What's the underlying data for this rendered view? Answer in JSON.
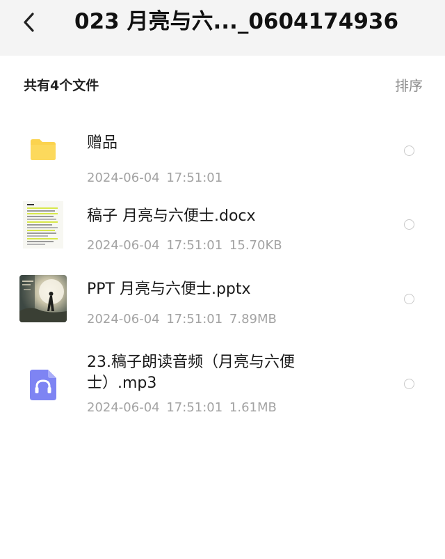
{
  "header": {
    "back_icon": "chevron-left-icon",
    "title": "023 月亮与六..._0604174936"
  },
  "summary": {
    "count_text": "共有4个文件",
    "sort_label": "排序"
  },
  "files": [
    {
      "name": "赠品",
      "date": "2024-06-04",
      "time": "17:51:01",
      "size": "",
      "icon": "folder-icon",
      "icon_color": "#fbd34e"
    },
    {
      "name": "稿子 月亮与六便士.docx",
      "date": "2024-06-04",
      "time": "17:51:01",
      "size": "15.70KB",
      "icon": "document-thumbnail"
    },
    {
      "name": "PPT 月亮与六便士.pptx",
      "date": "2024-06-04",
      "time": "17:51:01",
      "size": "7.89MB",
      "icon": "presentation-thumbnail"
    },
    {
      "name": "23.稿子朗读音频（月亮与六便士）.mp3",
      "date": "2024-06-04",
      "time": "17:51:01",
      "size": "1.61MB",
      "icon": "audio-file-icon",
      "icon_color": "#7e84f3"
    }
  ]
}
